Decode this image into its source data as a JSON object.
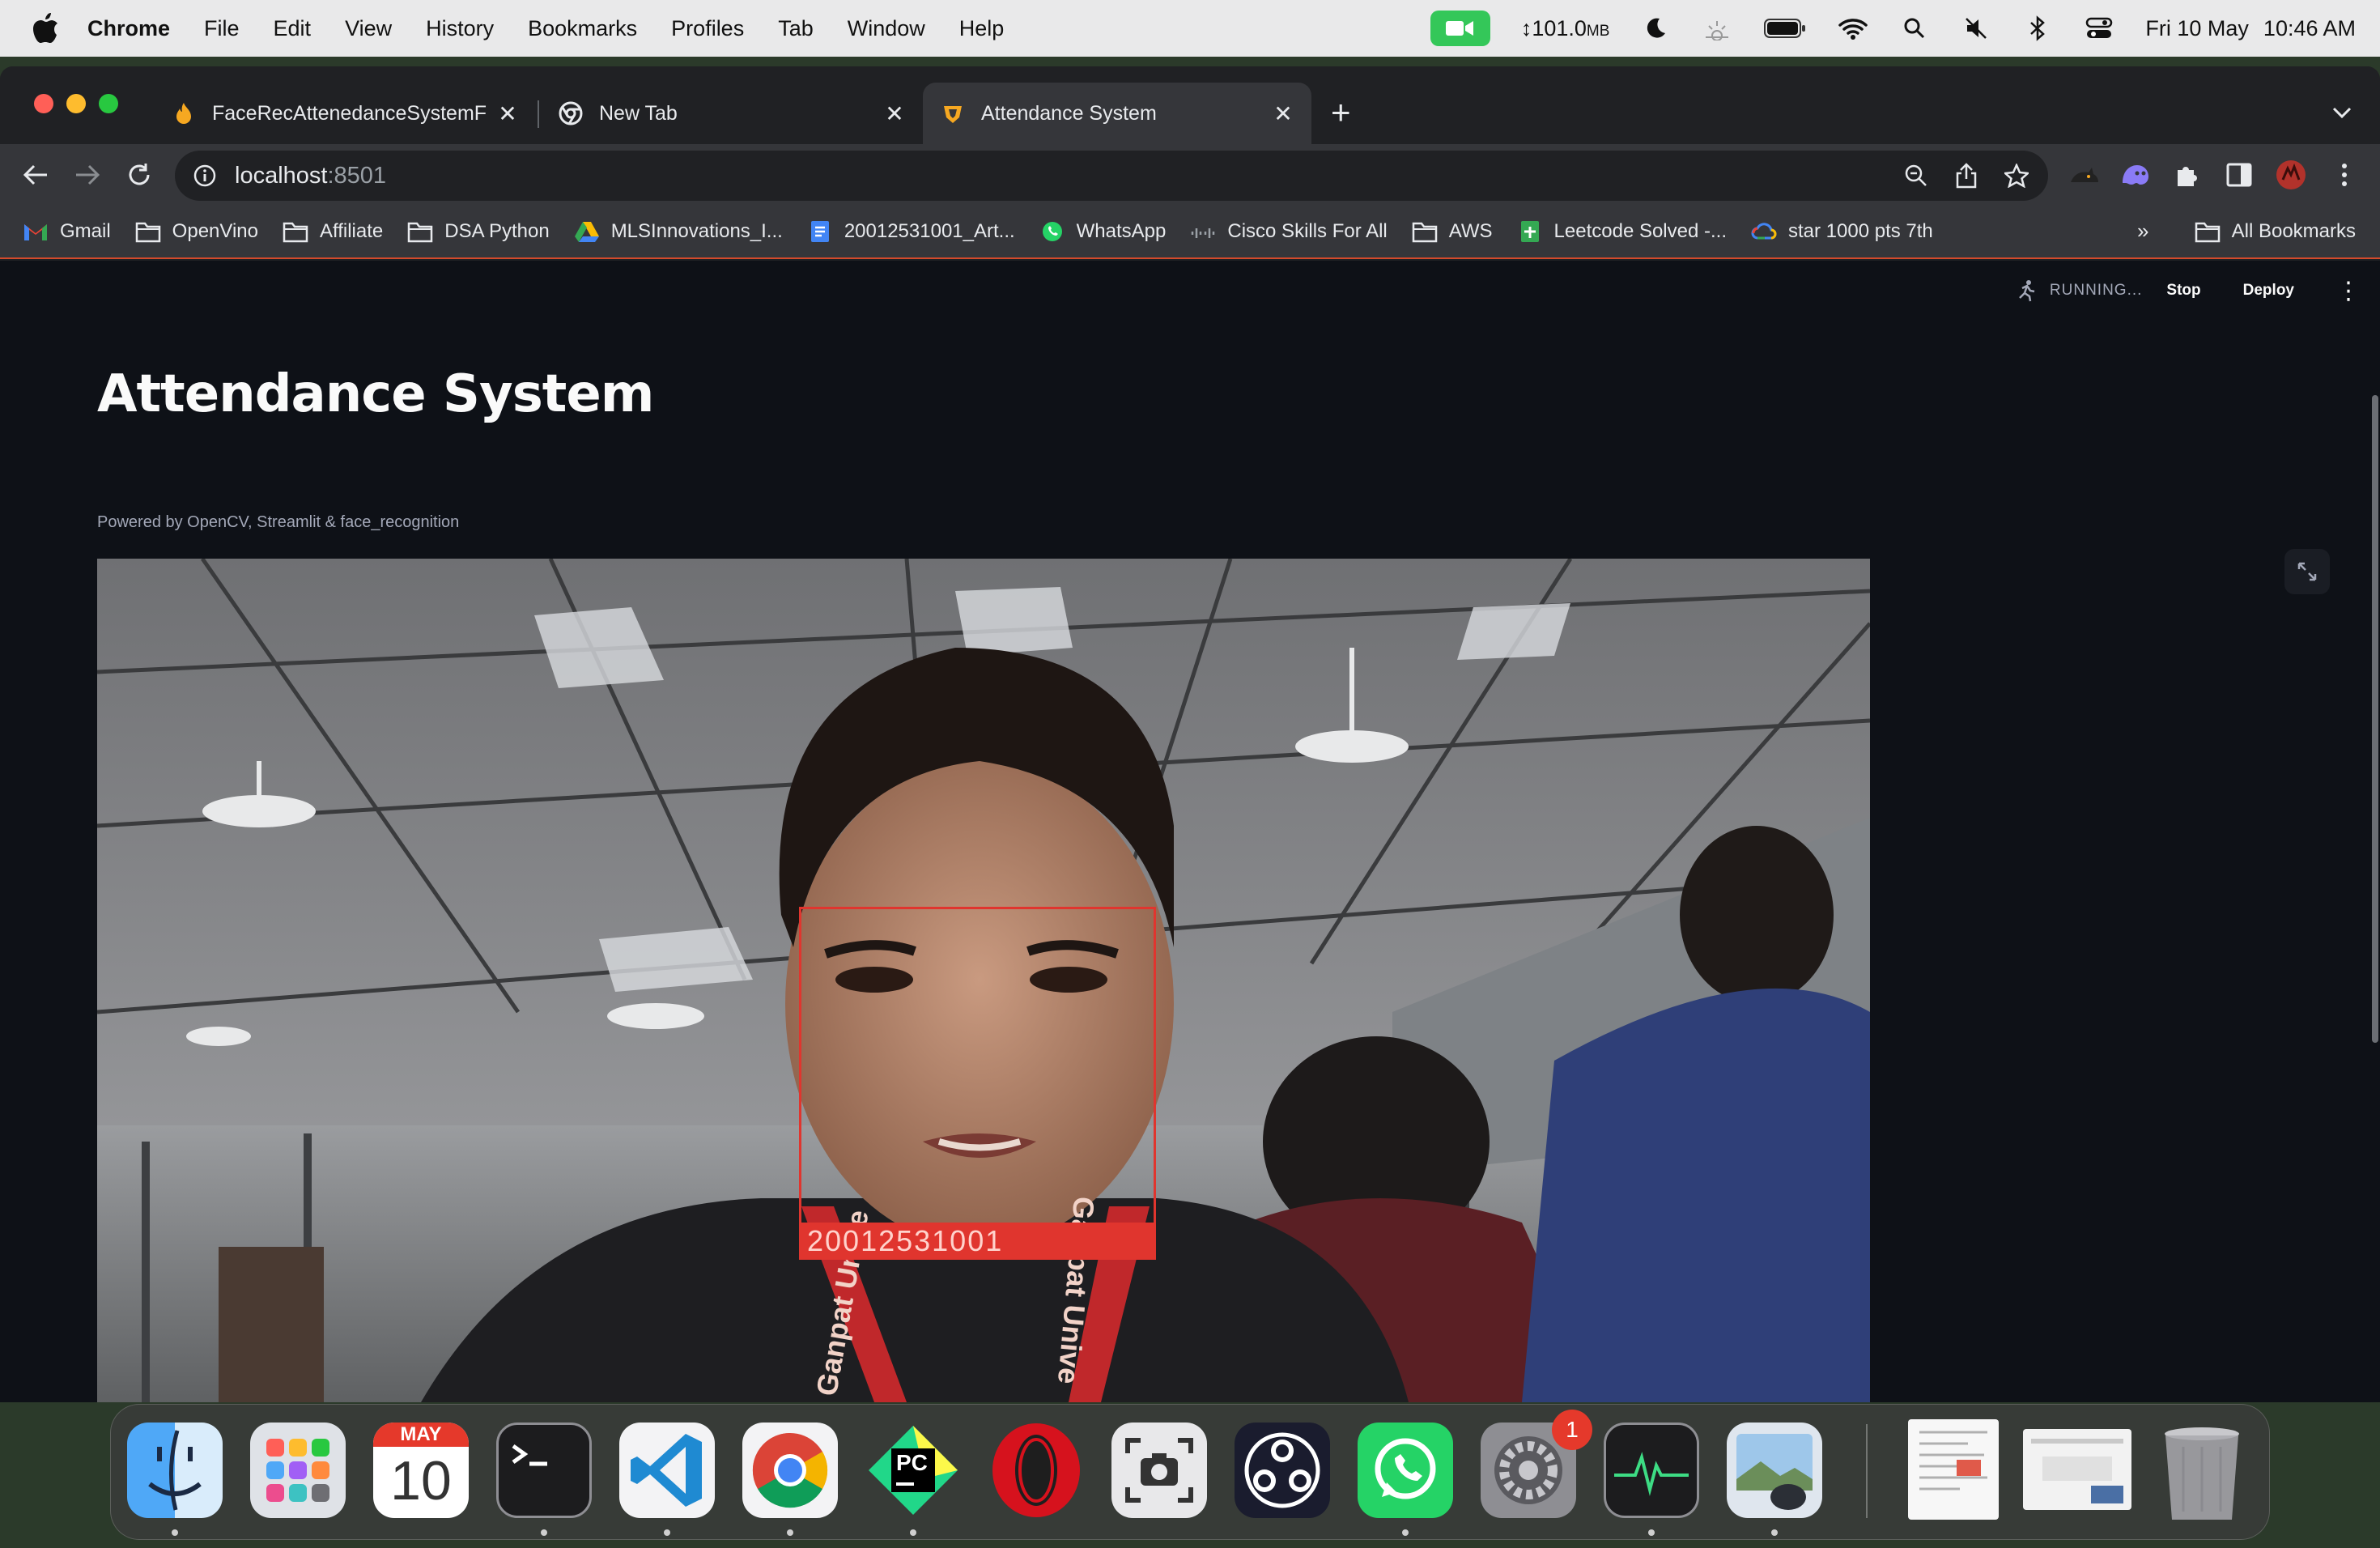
{
  "menubar": {
    "app_name": "Chrome",
    "menus": [
      "File",
      "Edit",
      "View",
      "History",
      "Bookmarks",
      "Profiles",
      "Tab",
      "Window",
      "Help"
    ],
    "memory_value": "101.0",
    "memory_unit": "MB",
    "memory_prefix": "↕",
    "date": "Fri 10 May",
    "time": "10:46 AM"
  },
  "browser": {
    "tabs": [
      {
        "label": "FaceRecAttenedanceSystemF",
        "active": false
      },
      {
        "label": "New Tab",
        "active": false
      },
      {
        "label": "Attendance System",
        "active": true
      }
    ],
    "address": {
      "host": "localhost",
      "port": ":8501"
    },
    "bookmarks": [
      {
        "label": "Gmail",
        "icon": "gmail-icon"
      },
      {
        "label": "OpenVino",
        "icon": "folder-icon"
      },
      {
        "label": "Affiliate",
        "icon": "folder-icon"
      },
      {
        "label": "DSA Python",
        "icon": "folder-icon"
      },
      {
        "label": "MLSInnovations_I...",
        "icon": "google-drive-icon"
      },
      {
        "label": "20012531001_Art...",
        "icon": "google-docs-icon"
      },
      {
        "label": "WhatsApp",
        "icon": "whatsapp-icon"
      },
      {
        "label": "Cisco Skills For All",
        "icon": "cisco-icon"
      },
      {
        "label": "AWS",
        "icon": "folder-icon"
      },
      {
        "label": "Leetcode Solved -...",
        "icon": "google-sheets-icon"
      },
      {
        "label": "star 1000 pts 7th",
        "icon": "google-cloud-icon"
      }
    ],
    "all_bookmarks": "All Bookmarks",
    "overflow": "»"
  },
  "app": {
    "status": "RUNNING...",
    "stop_label": "Stop",
    "deploy_label": "Deploy",
    "title": "Attendance System",
    "caption": "Powered by OpenCV, Streamlit & face_recognition",
    "face_label": "20012531001",
    "lanyard_left": "Ganpat Unive",
    "lanyard_right": "Ganpat Unive"
  },
  "dock": {
    "calendar_month": "MAY",
    "calendar_day": "10",
    "pycharm_label": "PC",
    "settings_badge": "1",
    "apps": [
      "finder",
      "launchpad",
      "calendar",
      "terminal",
      "vscode",
      "chrome",
      "pycharm",
      "opera",
      "screenshot",
      "obs",
      "whatsapp",
      "system-settings",
      "activity-monitor",
      "preview",
      "document-thumb-1",
      "document-thumb-2",
      "trash"
    ]
  },
  "colors": {
    "page_bg": "#0e1117",
    "detection_box": "#e0352e",
    "facetime_green": "#34c759"
  }
}
